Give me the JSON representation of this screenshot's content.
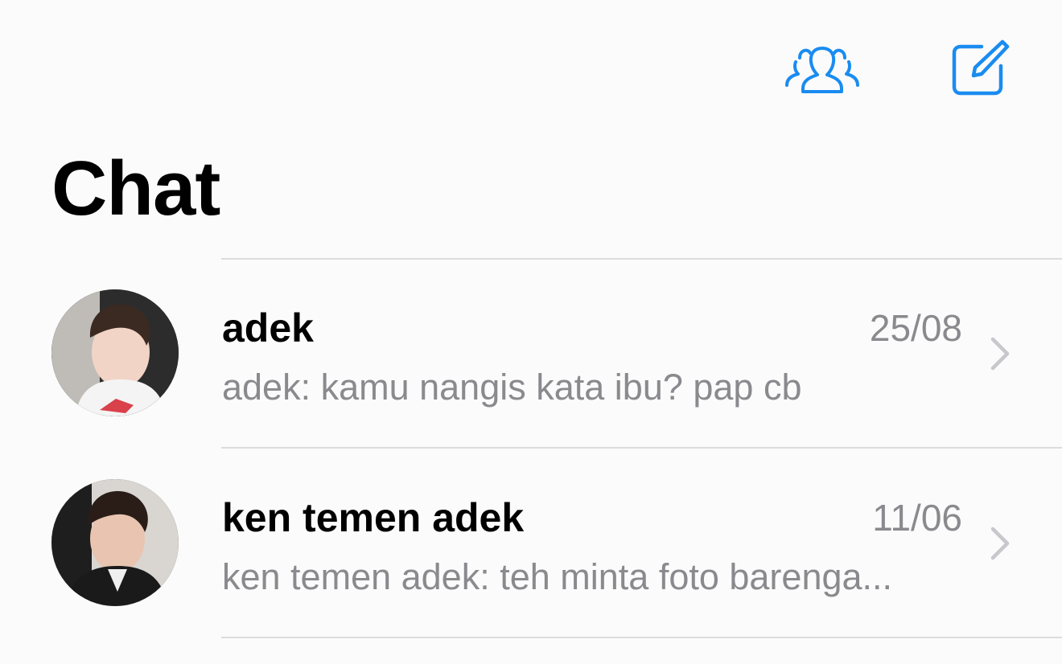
{
  "header": {
    "title": "Chat",
    "accent_color": "#1a8cf0",
    "group_icon": "people-icon",
    "compose_icon": "compose-icon"
  },
  "chats": [
    {
      "name": "adek",
      "date": "25/08",
      "preview": "adek: kamu nangis kata ibu? pap cb"
    },
    {
      "name": "ken temen adek",
      "date": "11/06",
      "preview": "ken temen adek: teh minta foto barenga..."
    }
  ]
}
